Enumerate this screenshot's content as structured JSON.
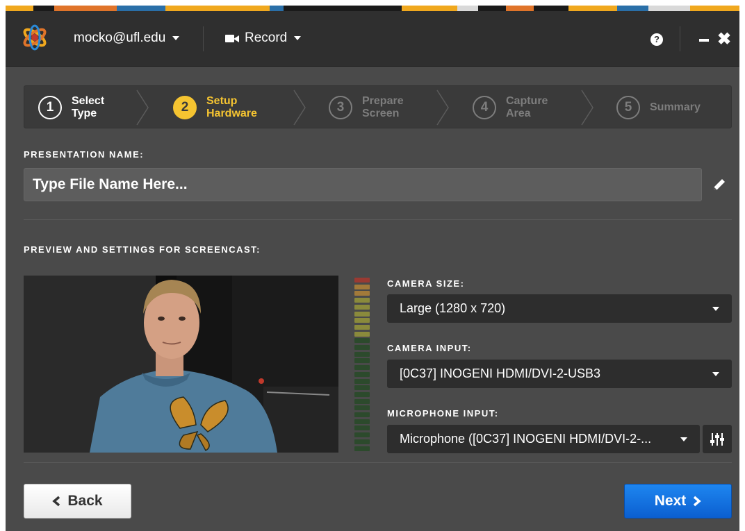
{
  "titlebar": {
    "user_label": "mocko@ufl.edu",
    "record_label": "Record",
    "help_glyph": "?",
    "close_glyph": "✖"
  },
  "steps": [
    {
      "number": "1",
      "label_line1": "Select",
      "label_line2": "Type",
      "state": "done"
    },
    {
      "number": "2",
      "label_line1": "Setup",
      "label_line2": "Hardware",
      "state": "active"
    },
    {
      "number": "3",
      "label_line1": "Prepare",
      "label_line2": "Screen",
      "state": "pending"
    },
    {
      "number": "4",
      "label_line1": "Capture",
      "label_line2": "Area",
      "state": "pending"
    },
    {
      "number": "5",
      "label_line1": "Summary",
      "label_line2": "",
      "state": "pending"
    }
  ],
  "presentation": {
    "heading": "PRESENTATION NAME:",
    "placeholder": "Type File Name Here..."
  },
  "preview_section": {
    "heading": "PREVIEW AND SETTINGS FOR SCREENCAST:"
  },
  "settings": {
    "camera_size_label": "CAMERA SIZE:",
    "camera_size_value": "Large (1280 x 720)",
    "camera_input_label": "CAMERA INPUT:",
    "camera_input_value": "[0C37] INOGENI HDMI/DVI-2-USB3",
    "microphone_input_label": "MICROPHONE INPUT:",
    "microphone_input_value": "Microphone ([0C37] INOGENI HDMI/DVI-2-..."
  },
  "footer": {
    "back_label": "Back",
    "next_label": "Next"
  },
  "colors": {
    "accent_yellow": "#f5c431",
    "primary_blue": "#1474e4",
    "window_bg": "#4a4a4a",
    "titlebar_bg": "#2f2f2f"
  },
  "icons": {
    "logo": "app-logo-icon",
    "record": "video-camera-icon",
    "help": "help-icon",
    "minimize": "minimize-icon",
    "close": "close-icon",
    "edit": "pencil-icon",
    "mixer": "mixer-icon"
  }
}
